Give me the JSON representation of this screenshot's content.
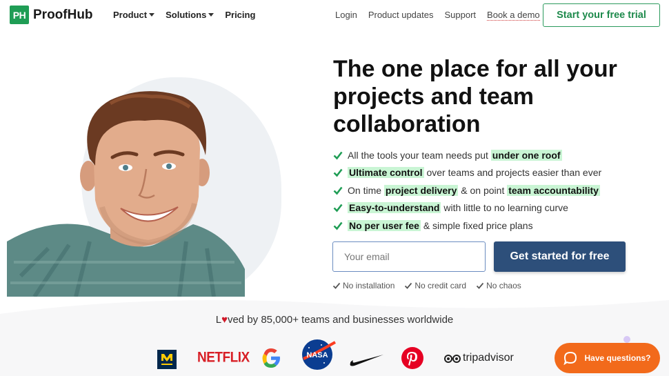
{
  "nav": {
    "logo_badge": "PH",
    "logo_text": "ProofHub",
    "menu": [
      "Product",
      "Solutions",
      "Pricing"
    ],
    "links": [
      "Login",
      "Product updates",
      "Support",
      "Book a demo"
    ],
    "cta": "Start your free trial"
  },
  "hero": {
    "headline": "The one place for all your projects and team collaboration",
    "features": [
      {
        "parts": [
          {
            "t": "All the tools your team needs put "
          },
          {
            "t": "under one roof",
            "hl": true
          }
        ]
      },
      {
        "parts": [
          {
            "t": "Ultimate control",
            "hl": true
          },
          {
            "t": " over teams and projects easier than ever"
          }
        ]
      },
      {
        "parts": [
          {
            "t": "On time "
          },
          {
            "t": "project delivery",
            "hl": true
          },
          {
            "t": " & on point "
          },
          {
            "t": "team accountability",
            "hl": true
          }
        ]
      },
      {
        "parts": [
          {
            "t": "Easy-to-understand",
            "hl": true
          },
          {
            "t": " with little to no learning curve"
          }
        ]
      },
      {
        "parts": [
          {
            "t": "No per user fee",
            "hl": true
          },
          {
            "t": " & simple fixed price plans"
          }
        ]
      }
    ],
    "email_placeholder": "Your email",
    "cta": "Get started for free",
    "assurances": [
      "No installation",
      "No credit card",
      "No chaos"
    ]
  },
  "social_proof": {
    "text_l": "L",
    "text_rest": "ved by 85,000+ teams and businesses worldwide",
    "logos": [
      "michigan-logo",
      "NETFLIX",
      "google-logo",
      "NASA",
      "nike-logo",
      "pinterest-logo",
      "tripadvisor"
    ]
  },
  "chat": {
    "label": "Have questions?"
  },
  "colors": {
    "brand_green": "#1f9d55",
    "cta_blue": "#2d4f7a",
    "highlight": "#c9f5d4",
    "chat_orange": "#f26a1b"
  }
}
